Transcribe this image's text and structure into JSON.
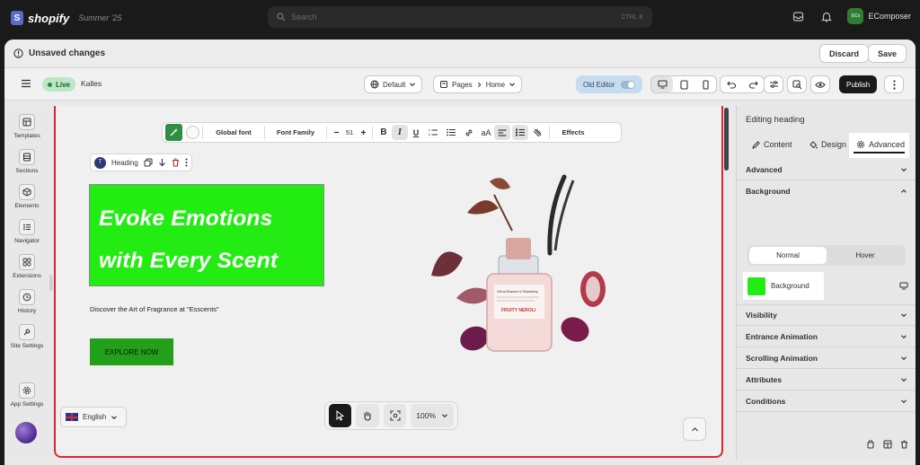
{
  "topbar": {
    "logo_letter": "S",
    "brand": "shopify",
    "edition": "Summer '25",
    "search_placeholder": "Search",
    "search_shortcut": "CTRL K",
    "store_avatar": "ECo",
    "store_name": "EComposer"
  },
  "unsaved": {
    "text": "Unsaved changes",
    "discard": "Discard",
    "save": "Save"
  },
  "toolbar": {
    "live": "Live",
    "theme": "Kalles",
    "locale": "Default",
    "page_section": "Pages",
    "page_name": "Home",
    "old_editor": "Old Editor",
    "publish": "Publish"
  },
  "sidebar": {
    "items": [
      {
        "label": "Templates",
        "icon": "templates-icon"
      },
      {
        "label": "Sections",
        "icon": "sections-icon"
      },
      {
        "label": "Elements",
        "icon": "elements-icon"
      },
      {
        "label": "Navigator",
        "icon": "navigator-icon"
      },
      {
        "label": "Extensions",
        "icon": "extensions-icon"
      },
      {
        "label": "History",
        "icon": "history-icon"
      },
      {
        "label": "Site Settings",
        "icon": "site-settings-icon"
      },
      {
        "label": "App Settings",
        "icon": "app-settings-icon"
      }
    ]
  },
  "texttools": {
    "global_font": "Global font",
    "font_family": "Font Family",
    "font_size": "51",
    "bold": "B",
    "italic": "I",
    "underline": "U",
    "case": "aA",
    "effects": "Effects"
  },
  "heading_bar": {
    "label": "Heading"
  },
  "hero": {
    "line1": "Evoke Emotions",
    "line2": "with Every Scent",
    "subtitle": "Discover the Art of Fragrance at \"Esscents\"",
    "cta": "EXPLORE NOW",
    "bottle_label": "FRUITY NEROLI",
    "bottle_small_text": "Citrus Blossom & Strawberry"
  },
  "canvas_controls": {
    "language": "English",
    "zoom": "100%"
  },
  "panel": {
    "title": "Editing heading",
    "tabs": [
      "Content",
      "Design",
      "Advanced"
    ],
    "sections": [
      "Advanced",
      "Background",
      "Visibility",
      "Entrance Animation",
      "Scrolling Animation",
      "Attributes",
      "Conditions"
    ],
    "states": [
      "Normal",
      "Hover"
    ],
    "background_label": "Background",
    "background_color": "#23ec13"
  }
}
